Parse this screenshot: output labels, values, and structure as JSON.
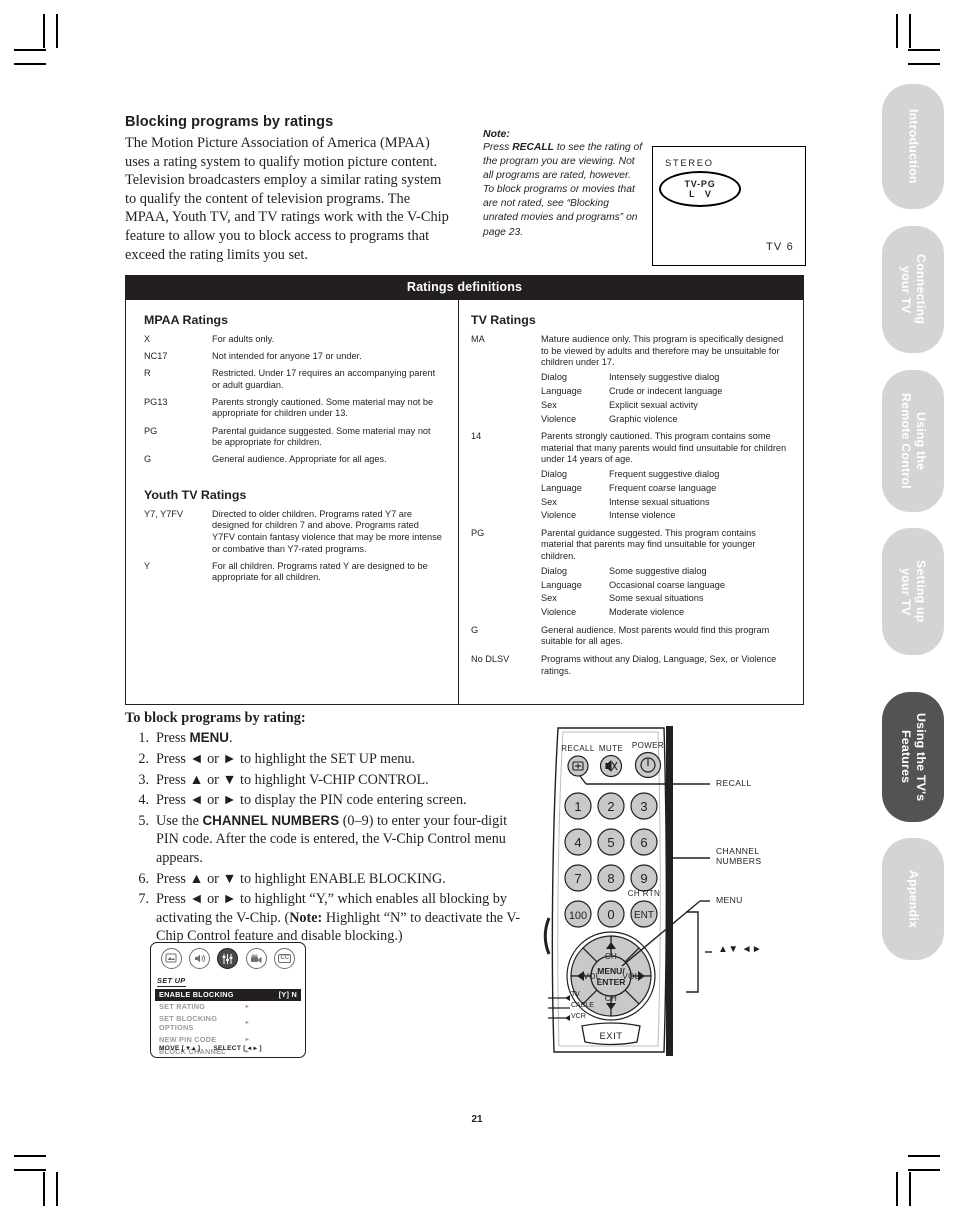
{
  "intro": {
    "heading": "Blocking programs by ratings",
    "paragraph": "The Motion Picture Association of America (MPAA) uses a rating system to qualify motion picture content. Television broadcasters employ a similar rating system to qualify the content of television programs. The MPAA, Youth TV, and TV ratings work with the V-Chip feature to allow you to block access to programs that exceed the rating limits you set."
  },
  "note": {
    "title": "Note:",
    "lead": "Press ",
    "emphasis": "RECALL",
    "body": " to see the rating of the program you are viewing. Not all programs are rated, however. To block programs or movies that are not rated, see “Blocking unrated movies and programs” on page 23."
  },
  "tv_screen": {
    "stereo": "STEREO",
    "rating_line1": "TV-PG",
    "rating_line2": "L  V",
    "channel": "TV  6"
  },
  "ratings": {
    "title": "Ratings definitions",
    "mpaa": {
      "heading": "MPAA Ratings",
      "rows": [
        {
          "code": "X",
          "desc": "For adults only."
        },
        {
          "code": "NC17",
          "desc": "Not intended for anyone 17 or under."
        },
        {
          "code": "R",
          "desc": "Restricted. Under 17 requires an accompanying parent or adult guardian."
        },
        {
          "code": "PG13",
          "desc": "Parents strongly cautioned. Some material may not be appropriate for children under 13."
        },
        {
          "code": "PG",
          "desc": "Parental guidance suggested. Some material may not be appropriate for children."
        },
        {
          "code": "G",
          "desc": "General audience. Appropriate for all ages."
        }
      ]
    },
    "youth": {
      "heading": "Youth TV Ratings",
      "rows": [
        {
          "code": "Y7, Y7FV",
          "desc": "Directed to older children. Programs rated Y7 are designed for children 7 and above. Programs rated Y7FV contain fantasy violence that may be more intense or combative than Y7-rated programs."
        },
        {
          "code": "Y",
          "desc": "For all children. Programs rated Y are designed to be appropriate for all children."
        }
      ]
    },
    "tv": {
      "heading": "TV Ratings",
      "rows": [
        {
          "code": "MA",
          "desc": "Mature audience only. This program is specifically designed to be viewed by adults and therefore may be unsuitable for children under 17.",
          "subs": [
            {
              "key": "Dialog",
              "val": "Intensely suggestive dialog"
            },
            {
              "key": "Language",
              "val": "Crude or indecent language"
            },
            {
              "key": "Sex",
              "val": "Explicit sexual activity"
            },
            {
              "key": "Violence",
              "val": "Graphic violence"
            }
          ]
        },
        {
          "code": "14",
          "desc": "Parents strongly cautioned. This program contains some material that many parents would find unsuitable for children under 14 years of age.",
          "subs": [
            {
              "key": "Dialog",
              "val": "Frequent suggestive dialog"
            },
            {
              "key": "Language",
              "val": "Frequent coarse language"
            },
            {
              "key": "Sex",
              "val": "Intense sexual situations"
            },
            {
              "key": "Violence",
              "val": "Intense violence"
            }
          ]
        },
        {
          "code": "PG",
          "desc": "Parental guidance suggested. This program contains material that parents may find unsuitable for younger children.",
          "subs": [
            {
              "key": "Dialog",
              "val": "Some suggestive dialog"
            },
            {
              "key": "Language",
              "val": "Occasional coarse language"
            },
            {
              "key": "Sex",
              "val": "Some sexual situations"
            },
            {
              "key": "Violence",
              "val": "Moderate violence"
            }
          ]
        },
        {
          "code": "G",
          "desc": "General audience. Most parents would find this program suitable for all ages.",
          "subs": []
        },
        {
          "code": "No DLSV",
          "desc": "Programs without any Dialog, Language, Sex, or Violence ratings.",
          "subs": []
        }
      ]
    }
  },
  "procedure": {
    "title": "To block programs by rating:",
    "steps": [
      {
        "num": "1.",
        "parts": [
          {
            "t": "Press "
          },
          {
            "t": "MENU",
            "k": true
          },
          {
            "t": "."
          }
        ]
      },
      {
        "num": "2.",
        "parts": [
          {
            "t": "Press ◄ or ► to highlight the SET UP menu."
          }
        ]
      },
      {
        "num": "3.",
        "parts": [
          {
            "t": "Press ▲ or ▼ to highlight V-CHIP CONTROL."
          }
        ]
      },
      {
        "num": "4.",
        "parts": [
          {
            "t": "Press ◄ or ► to display the PIN code entering screen."
          }
        ]
      },
      {
        "num": "5.",
        "parts": [
          {
            "t": "Use the "
          },
          {
            "t": "CHANNEL NUMBERS",
            "k": true
          },
          {
            "t": " (0–9) to enter your four-digit PIN code. After the code is entered, the V-Chip Control menu appears."
          }
        ]
      },
      {
        "num": "6.",
        "parts": [
          {
            "t": "Press ▲ or ▼ to highlight ENABLE BLOCKING."
          }
        ]
      },
      {
        "num": "7.",
        "parts": [
          {
            "t": "Press ◄ or ► to highlight “Y,” which enables all blocking by activating the V-Chip. ("
          },
          {
            "t": "Note:",
            "b": true
          },
          {
            "t": "  Highlight “N” to deactivate the V-Chip Control feature and disable blocking.)"
          }
        ]
      }
    ]
  },
  "osd": {
    "icons": [
      "picture-icon",
      "audio-icon",
      "setup-icon",
      "video-icon",
      "closed-caption-icon"
    ],
    "cc_label": "CC",
    "menu_label": "SET UP",
    "rows": [
      {
        "label": "ENABLE BLOCKING",
        "value": "[Y]  N",
        "arrow": "",
        "selected": true
      },
      {
        "label": "SET RATING",
        "value": "",
        "arrow": "▸",
        "selected": false
      },
      {
        "label": "SET BLOCKING OPTIONS",
        "value": "",
        "arrow": "▸",
        "selected": false
      },
      {
        "label": "NEW PIN CODE",
        "value": "",
        "arrow": "▸",
        "selected": false
      },
      {
        "label": "BLOCK CHANNEL",
        "value": "",
        "arrow": "▸",
        "selected": false
      }
    ],
    "footer_move": "MOVE [ ▾ ▴ ]",
    "footer_select": "SELECT [ ◂ ▸ ]"
  },
  "remote": {
    "labels": {
      "recall": "RECALL",
      "mute": "MUTE",
      "power": "POWER",
      "ch_rtn": "CH RTN",
      "ent": "ENT",
      "ch_up": "CH",
      "ch_down": "CH",
      "vol_left": "VOL",
      "vol_right": "VOL",
      "menu_enter_1": "MENU/",
      "menu_enter_2": "ENTER",
      "exit": "EXIT",
      "tv": "TV",
      "cable": "CABLE",
      "vcr": "VCR"
    },
    "keys": [
      "1",
      "2",
      "3",
      "4",
      "5",
      "6",
      "7",
      "8",
      "9",
      "100",
      "0"
    ],
    "callouts": [
      {
        "text": "RECALL"
      },
      {
        "text": "CHANNEL\nNUMBERS"
      },
      {
        "text": "MENU"
      },
      {
        "text": "▲▼ ◄►"
      }
    ]
  },
  "sidebar": {
    "tabs": [
      {
        "label": "Introduction",
        "active": false
      },
      {
        "label": "Connecting\nyour TV",
        "active": false
      },
      {
        "label": "Using the\nRemote Control",
        "active": false
      },
      {
        "label": "Setting up\nyour TV",
        "active": false
      },
      {
        "label": "Using the TV's\nFeatures",
        "active": true
      },
      {
        "label": "Appendix",
        "active": false
      }
    ]
  },
  "footer": {
    "page_number": "21"
  },
  "colors": {
    "ink": "#231f20",
    "tab_inactive": "#d4d4d4",
    "tab_active": "#545252",
    "bar": "#231f20"
  }
}
